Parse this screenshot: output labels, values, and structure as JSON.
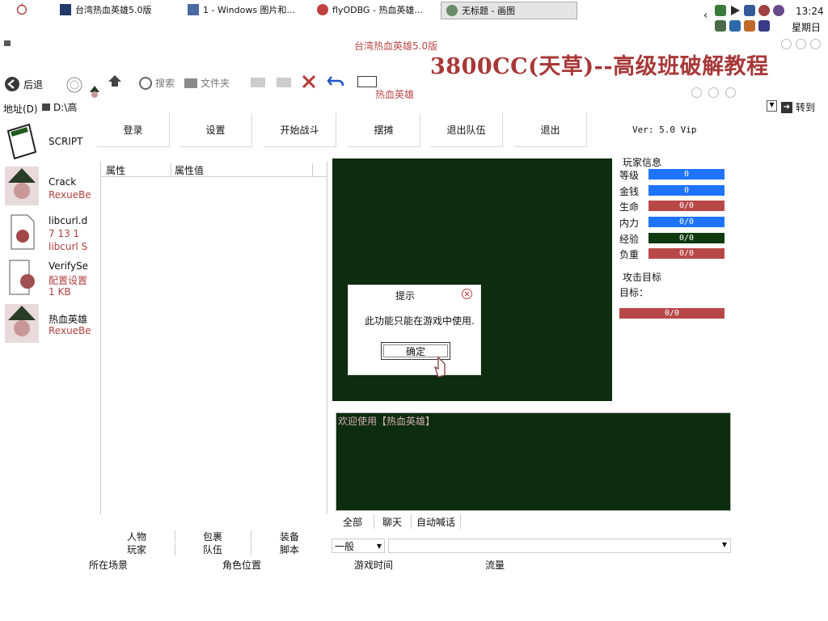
{
  "taskbar": {
    "tasks": [
      {
        "label": "台湾热血英雄5.0版"
      },
      {
        "label": "1 - Windows 图片和..."
      },
      {
        "label": "flyODBG - 热血英雄..."
      },
      {
        "label": "无标题 - 画图"
      }
    ],
    "clock": "13:24",
    "weekday": "星期日"
  },
  "explorer": {
    "title": "台湾热血英雄5.0版",
    "watermark": "3800CC(天草)--高级班破解教程",
    "back_label": "后退",
    "search_label": "搜索",
    "folders_label": "文件夹",
    "address_label": "地址(D)",
    "address_value": "D:\\高",
    "goto_label": "转到",
    "files": [
      {
        "name": "SCRIPT",
        "line2": "",
        "line3": ""
      },
      {
        "name": "Crack",
        "line2": "RexueBe",
        "line3": ""
      },
      {
        "name": "libcurl.d",
        "line2": "7 13 1",
        "line3": "libcurl S"
      },
      {
        "name": "VerifySe",
        "line2": "配置设置",
        "line3": "1 KB"
      },
      {
        "name": "热血英雄",
        "line2": "RexueBe",
        "line3": ""
      }
    ]
  },
  "app": {
    "title": "热血英雄",
    "menu": [
      "登录",
      "设置",
      "开始战斗",
      "摆摊",
      "退出队伍",
      "退出"
    ],
    "version": "Ver: 5.0 Vip",
    "prop_headers": [
      "属性",
      "属性值"
    ],
    "player_info_title": "玩家信息",
    "stats": [
      {
        "label": "等级",
        "value": "0",
        "color": "#1e73ff"
      },
      {
        "label": "金钱",
        "value": "0",
        "color": "#1e73ff"
      },
      {
        "label": "生命",
        "value": "0/0",
        "color": "#b84848"
      },
      {
        "label": "内力",
        "value": "0/0",
        "color": "#1e73ff"
      },
      {
        "label": "经验",
        "value": "0/0",
        "color": "#0f3a0f"
      },
      {
        "label": "负重",
        "value": "0/0",
        "color": "#b84848"
      }
    ],
    "attack_title": "攻击目标",
    "target_label": "目标：",
    "target_value": "0/0",
    "log_text": "欢迎使用【热血英雄】",
    "log_tabs": [
      "全部",
      "聊天",
      "自动喊话"
    ],
    "chat_channel": "一般",
    "left_tabs_row1": [
      "人物",
      "包裹",
      "装备"
    ],
    "left_tabs_row2": [
      "玩家",
      "队伍",
      "脚本"
    ],
    "status": [
      "所在场景",
      "角色位置",
      "游戏时间",
      "流量"
    ]
  },
  "dialog": {
    "title": "提示",
    "message": "此功能只能在游戏中使用.",
    "ok_label": "确定"
  }
}
